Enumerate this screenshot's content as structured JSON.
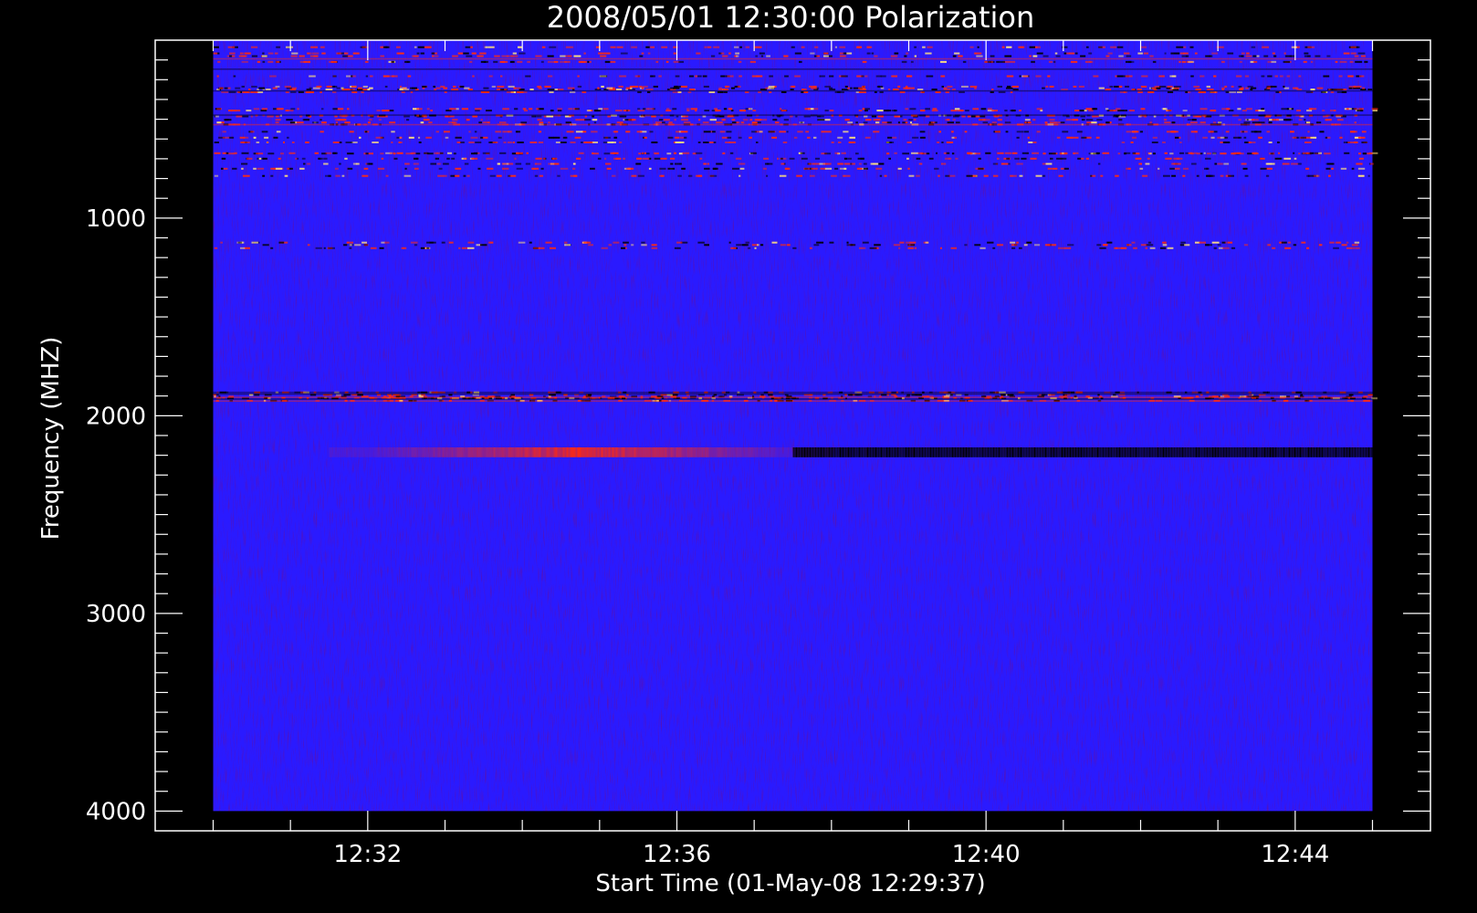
{
  "chart_data": {
    "type": "heatmap",
    "title": "2008/05/01 12:30:00 Polarization",
    "xlabel": "Start Time (01-May-08 12:29:37)",
    "ylabel": "Frequency (MHZ)",
    "x_tick_labels": [
      "12:32",
      "12:36",
      "12:40",
      "12:44"
    ],
    "x_tick_minutes": [
      32,
      36,
      40,
      44
    ],
    "y_tick_labels": [
      "1000",
      "2000",
      "3000",
      "4000"
    ],
    "y_tick_values": [
      1000,
      2000,
      3000,
      4000
    ],
    "xlim_minutes": [
      29.25,
      45.75
    ],
    "ylim": [
      4100,
      100
    ],
    "y_inverted": true,
    "data_xlim_minutes": [
      30.0,
      45.0
    ],
    "data_ylim": [
      4000,
      100
    ],
    "background_color": "#2a1aff",
    "colors": {
      "low": "#000000",
      "mid": "#1a1aff",
      "high": "#ff2a10",
      "peak": "#ffe080"
    },
    "features": [
      {
        "name": "rfi-top",
        "freq_from": 100,
        "freq_to": 800,
        "minute_from": 30.0,
        "minute_to": 45.0,
        "intensity": "mixed"
      },
      {
        "name": "band-1130",
        "freq_from": 1100,
        "freq_to": 1150,
        "minute_from": 30.0,
        "minute_to": 45.0,
        "intensity": "speckle"
      },
      {
        "name": "band-1900",
        "freq_from": 1870,
        "freq_to": 1930,
        "minute_from": 30.0,
        "minute_to": 45.0,
        "intensity": "mixed"
      },
      {
        "name": "band-2180-red",
        "freq_from": 2160,
        "freq_to": 2210,
        "minute_from": 31.5,
        "minute_to": 38.0,
        "intensity": "high"
      },
      {
        "name": "band-2180-black",
        "freq_from": 2160,
        "freq_to": 2210,
        "minute_from": 37.5,
        "minute_to": 45.0,
        "intensity": "low"
      }
    ]
  }
}
